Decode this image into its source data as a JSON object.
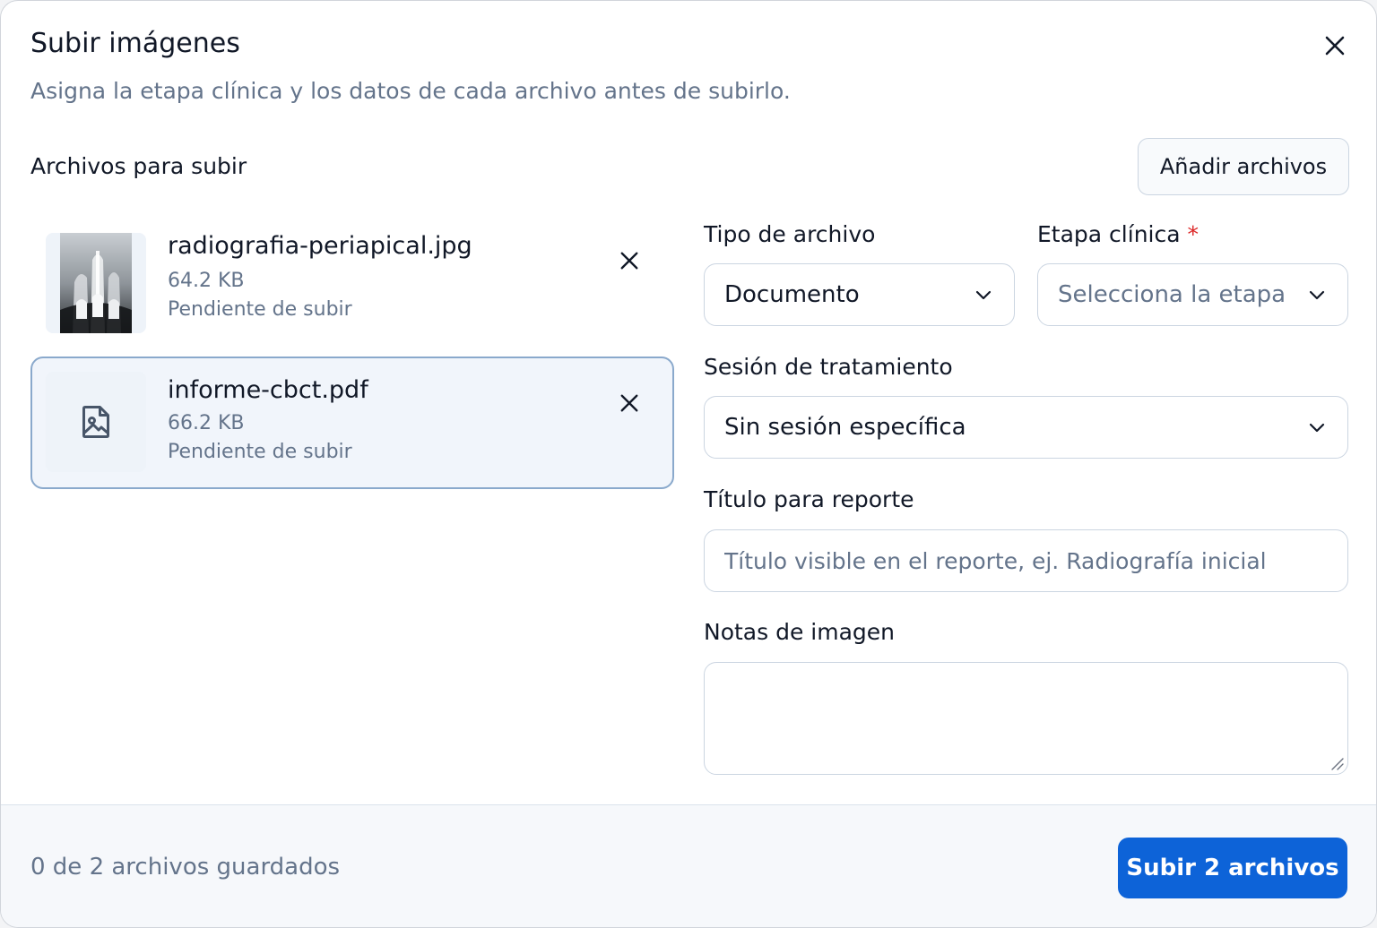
{
  "dialog": {
    "title": "Subir imágenes",
    "subtitle": "Asigna la etapa clínica y los datos de cada archivo antes de subirlo."
  },
  "files_section": {
    "label": "Archivos para subir",
    "add_button": "Añadir archivos"
  },
  "files": [
    {
      "name": "radiografia-periapical.jpg",
      "size": "64.2 KB",
      "status": "Pendiente de subir",
      "thumbnail": "xray-image",
      "selected": false
    },
    {
      "name": "informe-cbct.pdf",
      "size": "66.2 KB",
      "status": "Pendiente de subir",
      "thumbnail": "file-image-icon",
      "selected": true
    }
  ],
  "form": {
    "file_type": {
      "label": "Tipo de archivo",
      "value": "Documento"
    },
    "clinical_stage": {
      "label": "Etapa clínica",
      "required_mark": "*",
      "placeholder": "Selecciona la etapa"
    },
    "session": {
      "label": "Sesión de tratamiento",
      "value": "Sin sesión específica"
    },
    "report_title": {
      "label": "Título para reporte",
      "placeholder": "Título visible en el reporte, ej. Radiografía inicial",
      "value": ""
    },
    "notes": {
      "label": "Notas de imagen",
      "value": ""
    }
  },
  "footer": {
    "saved_count": "0 de 2 archivos guardados",
    "upload_button": "Subir 2 archivos"
  },
  "colors": {
    "primary": "#0d63d8",
    "required": "#dc2626",
    "selected_border": "#8aa9cc",
    "muted_text": "#64748b"
  }
}
